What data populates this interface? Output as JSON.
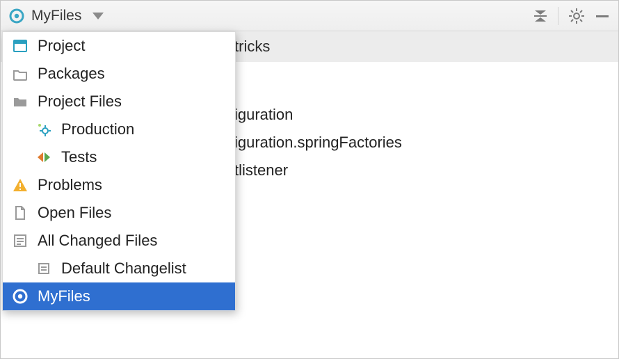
{
  "toolbar": {
    "scope_label": "MyFiles"
  },
  "bg": {
    "heading_tail": "tricks",
    "lines": [
      "iguration",
      "iguration.springFactories",
      "tlistener"
    ]
  },
  "dropdown": {
    "items": [
      {
        "label": "Project",
        "icon": "project-icon",
        "indent": false,
        "selected": false
      },
      {
        "label": "Packages",
        "icon": "packages-icon",
        "indent": false,
        "selected": false
      },
      {
        "label": "Project Files",
        "icon": "folder-icon",
        "indent": false,
        "selected": false
      },
      {
        "label": "Production",
        "icon": "production-icon",
        "indent": true,
        "selected": false
      },
      {
        "label": "Tests",
        "icon": "tests-icon",
        "indent": true,
        "selected": false
      },
      {
        "label": "Problems",
        "icon": "problems-icon",
        "indent": false,
        "selected": false
      },
      {
        "label": "Open Files",
        "icon": "openfiles-icon",
        "indent": false,
        "selected": false
      },
      {
        "label": "All Changed Files",
        "icon": "changed-icon",
        "indent": false,
        "selected": false
      },
      {
        "label": "Default Changelist",
        "icon": "changelist-icon",
        "indent": true,
        "selected": false
      },
      {
        "label": "MyFiles",
        "icon": "target-icon",
        "indent": false,
        "selected": true
      }
    ]
  }
}
